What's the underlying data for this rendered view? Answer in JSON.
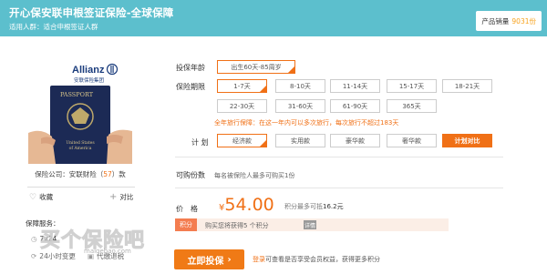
{
  "header": {
    "title": "开心保安联申根签证保险-全球保障",
    "audience_label": "适用人群：",
    "audience": "适合申根签证人群",
    "sales_label": "产品销量",
    "sales_value": "9031份"
  },
  "left": {
    "brand": "Allianz",
    "brand_cn": "安联保险集团",
    "passport_word": "PASSPORT",
    "country_line1": "United States",
    "country_line2": "of America",
    "company_prefix": "保险公司：安联财险（",
    "company_count": "57",
    "company_suffix": "）款",
    "favorite": "收藏",
    "compare": "对比",
    "service_title": "保障服务：",
    "service_1": "7x24",
    "service_2": "24小时变更",
    "service_3": "代缴退税",
    "watermark": "买个保险吧",
    "watermark_url": "maigebao.com"
  },
  "options": {
    "age_label": "投保年龄",
    "age": [
      "出生60天-85周岁"
    ],
    "period_label": "保险期限",
    "periods_row1": [
      "1-7天",
      "8-10天",
      "11-14天",
      "15-17天",
      "18-21天"
    ],
    "periods_row2": [
      "22-30天",
      "31-60天",
      "61-90天",
      "365天"
    ],
    "note": "全年旅行保障：在这一年内可以多次旅行，每次旅行不超过183天",
    "plan_label": "计  划",
    "plans": [
      "经济款",
      "实用款",
      "豪华款",
      "奢华款"
    ],
    "plan_compare": "计划对比",
    "buyable_label": "可购份数",
    "buyable_text": "每名被保险人最多可购买1份"
  },
  "pricing": {
    "price_label": "价格",
    "currency": "¥",
    "amount": "54.00",
    "points_prefix": "积分最多可抵",
    "points_value": "16.2元",
    "jifen_tag": "积分",
    "jifen_text": "购买您将获得5 个积分",
    "jifen_btn": "详情",
    "buy_label": "立即投保",
    "buy_note_link": "登录",
    "buy_note": "可查看是否享受会员权益，获得更多积分"
  },
  "colors": {
    "header": "#5cbfcd",
    "accent": "#f07016"
  }
}
